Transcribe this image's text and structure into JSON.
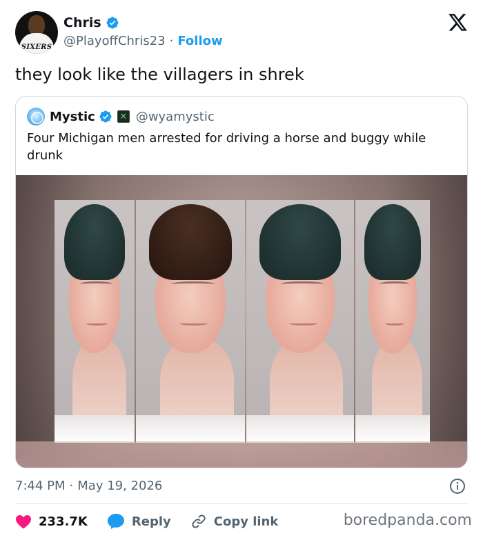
{
  "author": {
    "name": "Chris",
    "handle": "@PlayoffChris23",
    "separator": "·",
    "follow_label": "Follow",
    "avatar_jersey_text": "SIXERS"
  },
  "tweet": {
    "text": "they look like the villagers in shrek"
  },
  "quoted": {
    "name": "Mystic",
    "handle": "@wyamystic",
    "badge_glyph": "✕",
    "text": "Four Michigan men arrested for driving a horse and buggy while drunk"
  },
  "meta": {
    "time": "7:44 PM",
    "separator": "·",
    "date": "May 19, 2026"
  },
  "actions": {
    "likes": "233.7K",
    "reply_label": "Reply",
    "copy_label": "Copy link"
  },
  "watermark": "boredpanda.com",
  "icons": [
    "verified-icon",
    "x-logo-icon",
    "info-icon",
    "heart-icon",
    "reply-icon",
    "link-icon"
  ],
  "colors": {
    "accent": "#1d9bf0",
    "like": "#f91880",
    "muted": "#536471",
    "text": "#0f1419",
    "border": "#cfd9de"
  }
}
